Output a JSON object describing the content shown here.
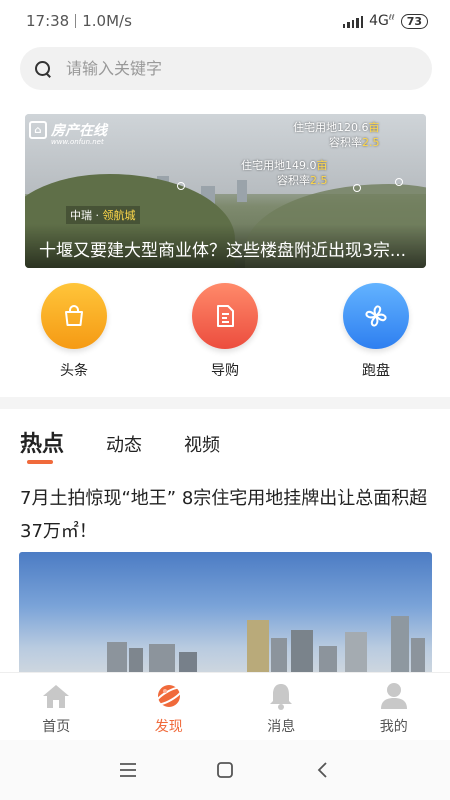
{
  "status_bar": {
    "time": "17:38",
    "speed": "1.0M/s",
    "network": "4G",
    "battery": "73"
  },
  "search": {
    "placeholder": "请输入关键字"
  },
  "banner": {
    "logo_text": "房产在线",
    "logo_url": "www.onfun.net",
    "tag1_line1_prefix": "住宅用地120.6",
    "tag1_line1_unit": "亩",
    "tag1_line2_prefix": "容积率",
    "tag1_line2_value": "2.5",
    "tag2_line1_prefix": "住宅用地149.0",
    "tag2_line1_unit": "亩",
    "tag2_line2_prefix": "容积率",
    "tag2_line2_value": "2.5",
    "location_prefix": "中瑞 · ",
    "location_name": "领航城",
    "caption": "十堰又要建大型商业体？这些楼盘附近出现3宗..."
  },
  "quick_entries": [
    {
      "label": "头条",
      "icon": "shopping-bag-icon",
      "color_from": "#ffc53a",
      "color_to": "#f59a14"
    },
    {
      "label": "导购",
      "icon": "document-icon",
      "color_from": "#ff8a6a",
      "color_to": "#ec4d3e"
    },
    {
      "label": "跑盘",
      "icon": "fan-icon",
      "color_from": "#63b3ff",
      "color_to": "#2e7ff0"
    }
  ],
  "tabs": [
    {
      "label": "热点",
      "active": true
    },
    {
      "label": "动态",
      "active": false
    },
    {
      "label": "视频",
      "active": false
    }
  ],
  "article": {
    "title": "7月土拍惊现“地王” 8宗住宅用地挂牌出让总面积超37万㎡！"
  },
  "bottom_nav": [
    {
      "label": "首页",
      "icon": "home-icon",
      "active": false
    },
    {
      "label": "发现",
      "icon": "planet-icon",
      "active": true
    },
    {
      "label": "消息",
      "icon": "bell-icon",
      "active": false
    },
    {
      "label": "我的",
      "icon": "person-icon",
      "active": false
    }
  ],
  "colors": {
    "accent": "#f06a3b",
    "inactive_icon": "#c8c8c8"
  }
}
